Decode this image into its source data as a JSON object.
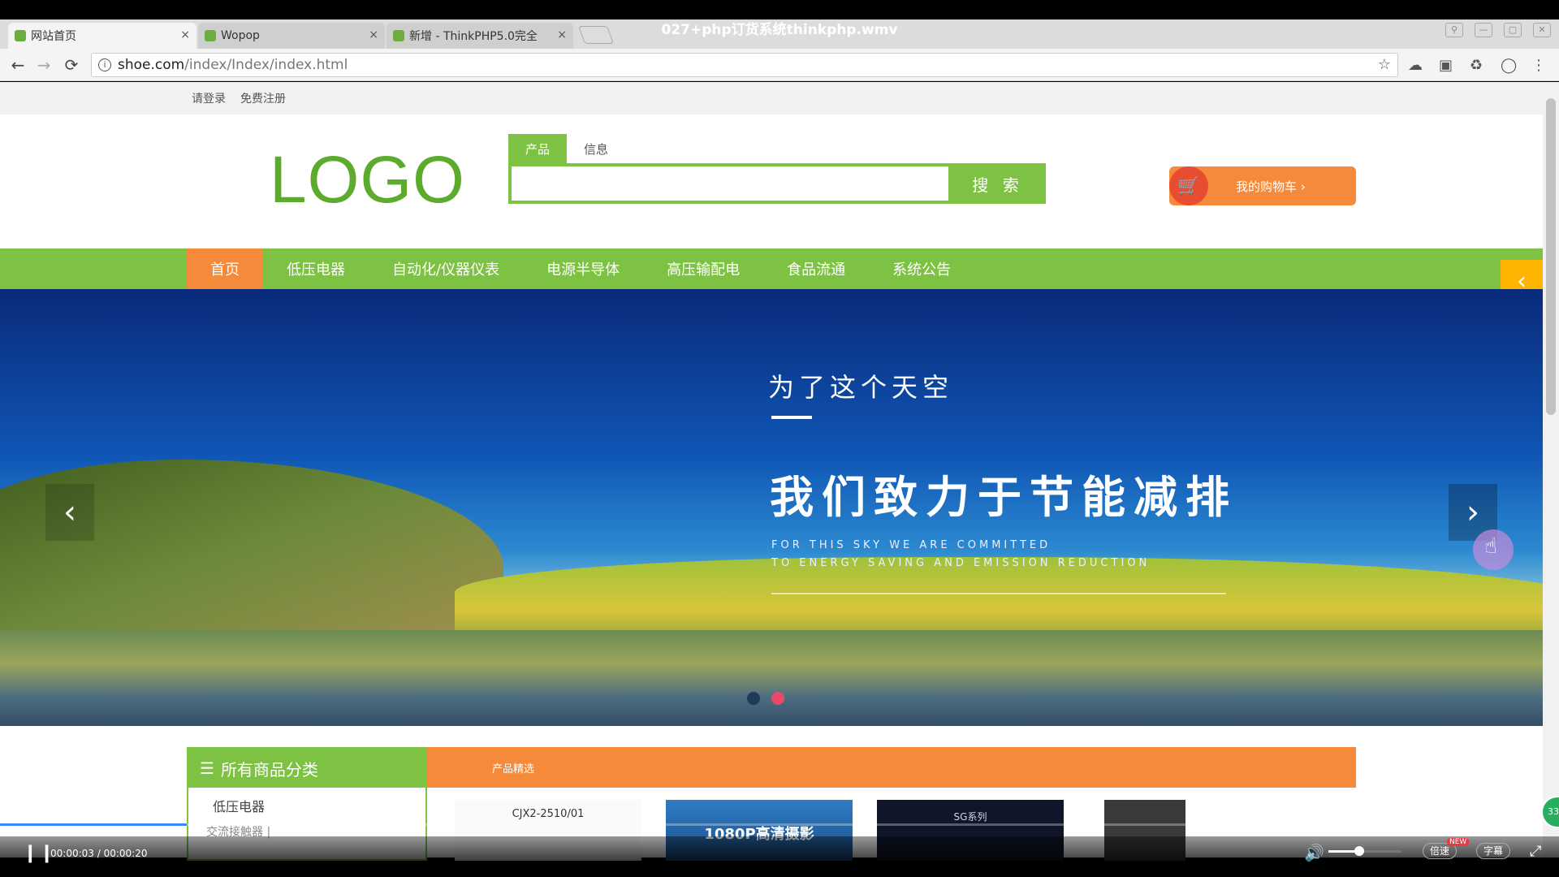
{
  "video": {
    "title": "027+php订货系统thinkphp.wmv",
    "time_display": "00:00:03 / 00:00:20",
    "progress": 0.12,
    "volume": 0.4,
    "speed_label": "倍速",
    "speed_badge": "NEW",
    "subtitle_label": "字幕",
    "badge_count": "33"
  },
  "browser": {
    "tabs": [
      {
        "label": "网站首页",
        "active": true
      },
      {
        "label": "Wopop",
        "active": false
      },
      {
        "label": "新增 - ThinkPHP5.0完全",
        "active": false
      }
    ],
    "close_glyph": "×",
    "url_host": "shoe.com",
    "url_path": "/index/Index/index.html"
  },
  "site": {
    "topbar": {
      "login": "请登录",
      "register": "免费注册"
    },
    "logo": "LOGO",
    "search": {
      "tabs": [
        "产品",
        "信息"
      ],
      "button": "搜 索",
      "value": ""
    },
    "cart_label": "我的购物车 ›",
    "nav": [
      "首页",
      "低压电器",
      "自动化/仪器仪表",
      "电源半导体",
      "高压输配电",
      "食品流通",
      "系统公告"
    ],
    "banner": {
      "line1": "为了这个天空",
      "line2": "我们致力于节能减排",
      "en1": "FOR THIS SKY  WE ARE COMMITTED",
      "en2": "TO ENERGY SAVING AND EMISSION REDUCTION",
      "active_slide": 2,
      "slide_count": 2
    },
    "category": {
      "header": "所有商品分类",
      "items": [
        {
          "label": "低压电器",
          "sub": "交流接触器 |"
        }
      ]
    },
    "products": {
      "bar_label": "产品精选",
      "items": [
        "CJX2-2510/01",
        "1080P高清摄影",
        "SG系列"
      ]
    }
  },
  "colors": {
    "brand_green": "#7dc242",
    "accent_orange": "#f58b3a",
    "cart_red": "#e94d30"
  }
}
